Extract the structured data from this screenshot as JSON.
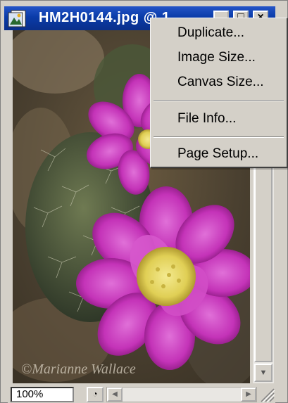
{
  "window": {
    "title": "HM2H0144.jpg @ 1",
    "minimize_label": "_",
    "maximize_label": "□",
    "close_label": "×"
  },
  "document": {
    "watermark": "©Marianne Wallace"
  },
  "context_menu": {
    "items": [
      {
        "label": "Duplicate..."
      },
      {
        "label": "Image Size..."
      },
      {
        "label": "Canvas Size..."
      },
      {
        "label": "File Info..."
      },
      {
        "label": "Page Setup..."
      }
    ]
  },
  "status": {
    "zoom": "100%"
  },
  "colors": {
    "title_bar": "#0a3ba8",
    "flower": "#c433b8",
    "flower_center": "#e8d860"
  }
}
